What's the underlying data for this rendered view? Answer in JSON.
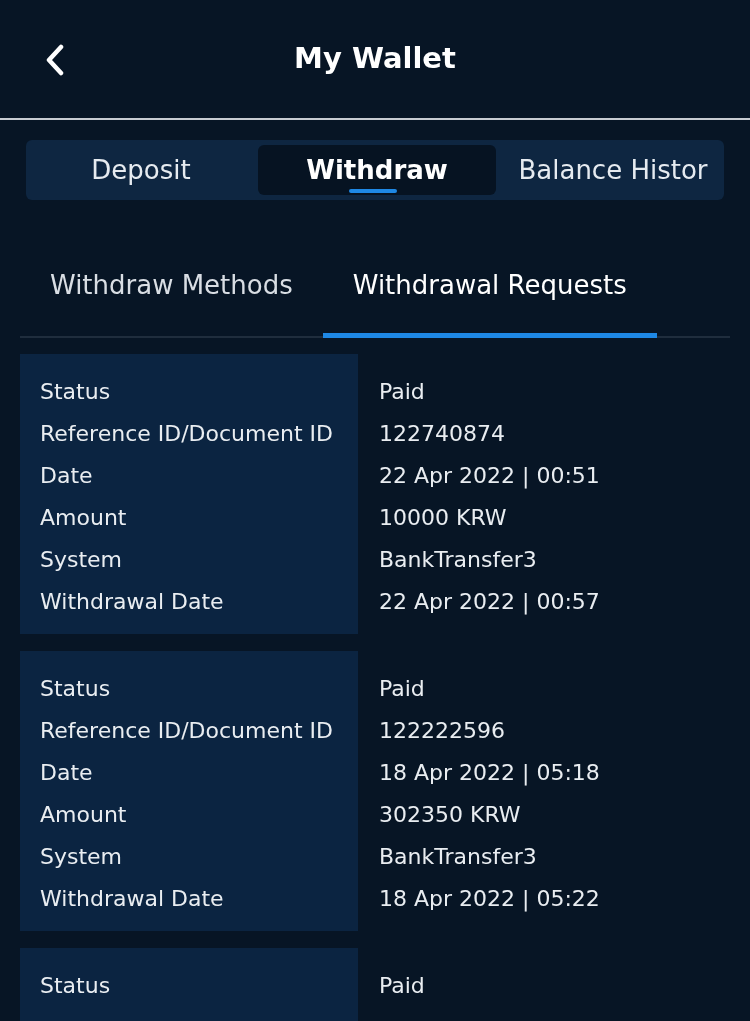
{
  "header": {
    "title": "My Wallet"
  },
  "tabs": [
    {
      "label": "Deposit",
      "selected": false
    },
    {
      "label": "Withdraw",
      "selected": true
    },
    {
      "label": "Balance Histor",
      "selected": false
    }
  ],
  "subtabs": [
    {
      "label": "Withdraw Methods",
      "selected": false
    },
    {
      "label": "Withdrawal Requests",
      "selected": true
    }
  ],
  "requests": [
    {
      "rows": [
        {
          "label": "Status",
          "value": "Paid"
        },
        {
          "label": "Reference ID/Document ID",
          "value": "122740874"
        },
        {
          "label": "Date",
          "value": "22 Apr 2022 | 00:51"
        },
        {
          "label": "Amount",
          "value": "10000 KRW"
        },
        {
          "label": "System",
          "value": "BankTransfer3"
        },
        {
          "label": "Withdrawal Date",
          "value": "22 Apr 2022 | 00:57"
        }
      ]
    },
    {
      "rows": [
        {
          "label": "Status",
          "value": "Paid"
        },
        {
          "label": "Reference ID/Document ID",
          "value": "122222596"
        },
        {
          "label": "Date",
          "value": "18 Apr 2022 | 05:18"
        },
        {
          "label": "Amount",
          "value": "302350 KRW"
        },
        {
          "label": "System",
          "value": "BankTransfer3"
        },
        {
          "label": "Withdrawal Date",
          "value": "18 Apr 2022 | 05:22"
        }
      ]
    },
    {
      "rows": [
        {
          "label": "Status",
          "value": "Paid"
        }
      ]
    }
  ]
}
